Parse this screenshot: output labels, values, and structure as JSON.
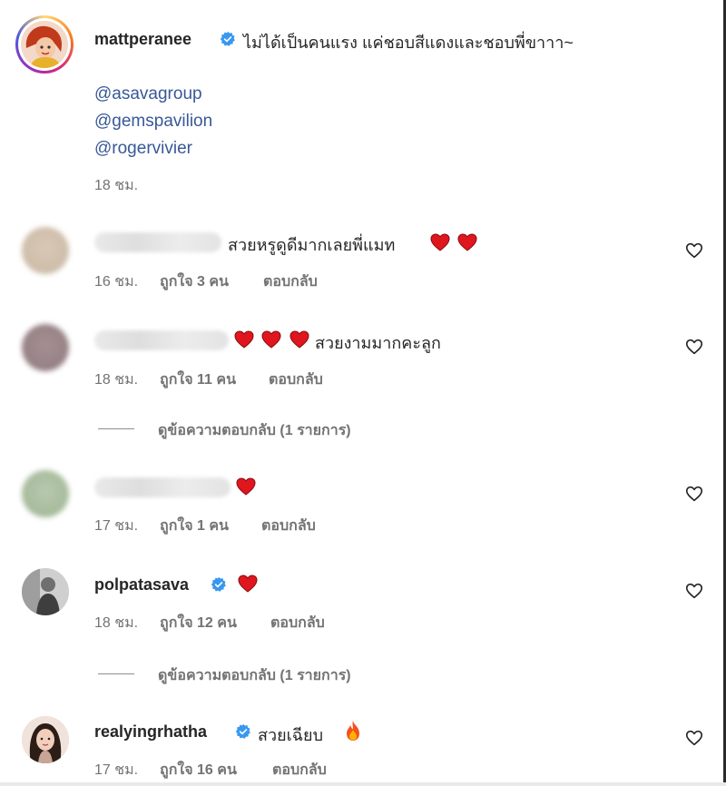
{
  "post": {
    "username": "mattperanee",
    "caption": "ไม่ได้เป็นคนแรง แค่ชอบสีแดงและชอบพี่ขาาา~",
    "mentions": [
      "@asavagroup",
      "@gemspavilion",
      "@rogervivier"
    ],
    "time": "18 ชม."
  },
  "comments": [
    {
      "text": "สวยหรูดูดีมากเลยพี่แมท",
      "time": "16 ชม.",
      "likes": "ถูกใจ 3 คน",
      "reply": "ตอบกลับ"
    },
    {
      "text": "สวยงามมากคะลูก",
      "time": "18 ชม.",
      "likes": "ถูกใจ 11 คน",
      "reply": "ตอบกลับ",
      "view_replies": "ดูข้อความตอบกลับ (1 รายการ)"
    },
    {
      "text": "",
      "time": "17 ชม.",
      "likes": "ถูกใจ 1 คน",
      "reply": "ตอบกลับ"
    },
    {
      "username": "polpatasava",
      "time": "18 ชม.",
      "likes": "ถูกใจ 12 คน",
      "reply": "ตอบกลับ",
      "view_replies": "ดูข้อความตอบกลับ (1 รายการ)"
    },
    {
      "username": "realyingrhatha",
      "text": "สวยเฉียบ",
      "time": "17 ชม.",
      "likes": "ถูกใจ 16 คน",
      "reply": "ตอบกลับ"
    }
  ],
  "colors": {
    "heart": "#e0161e",
    "verified": "#3897f0",
    "mention": "#385898",
    "meta": "#737373"
  },
  "icons": [
    "verified-badge-icon",
    "red-heart-emoji",
    "fire-emoji",
    "like-heart-outline-icon"
  ]
}
